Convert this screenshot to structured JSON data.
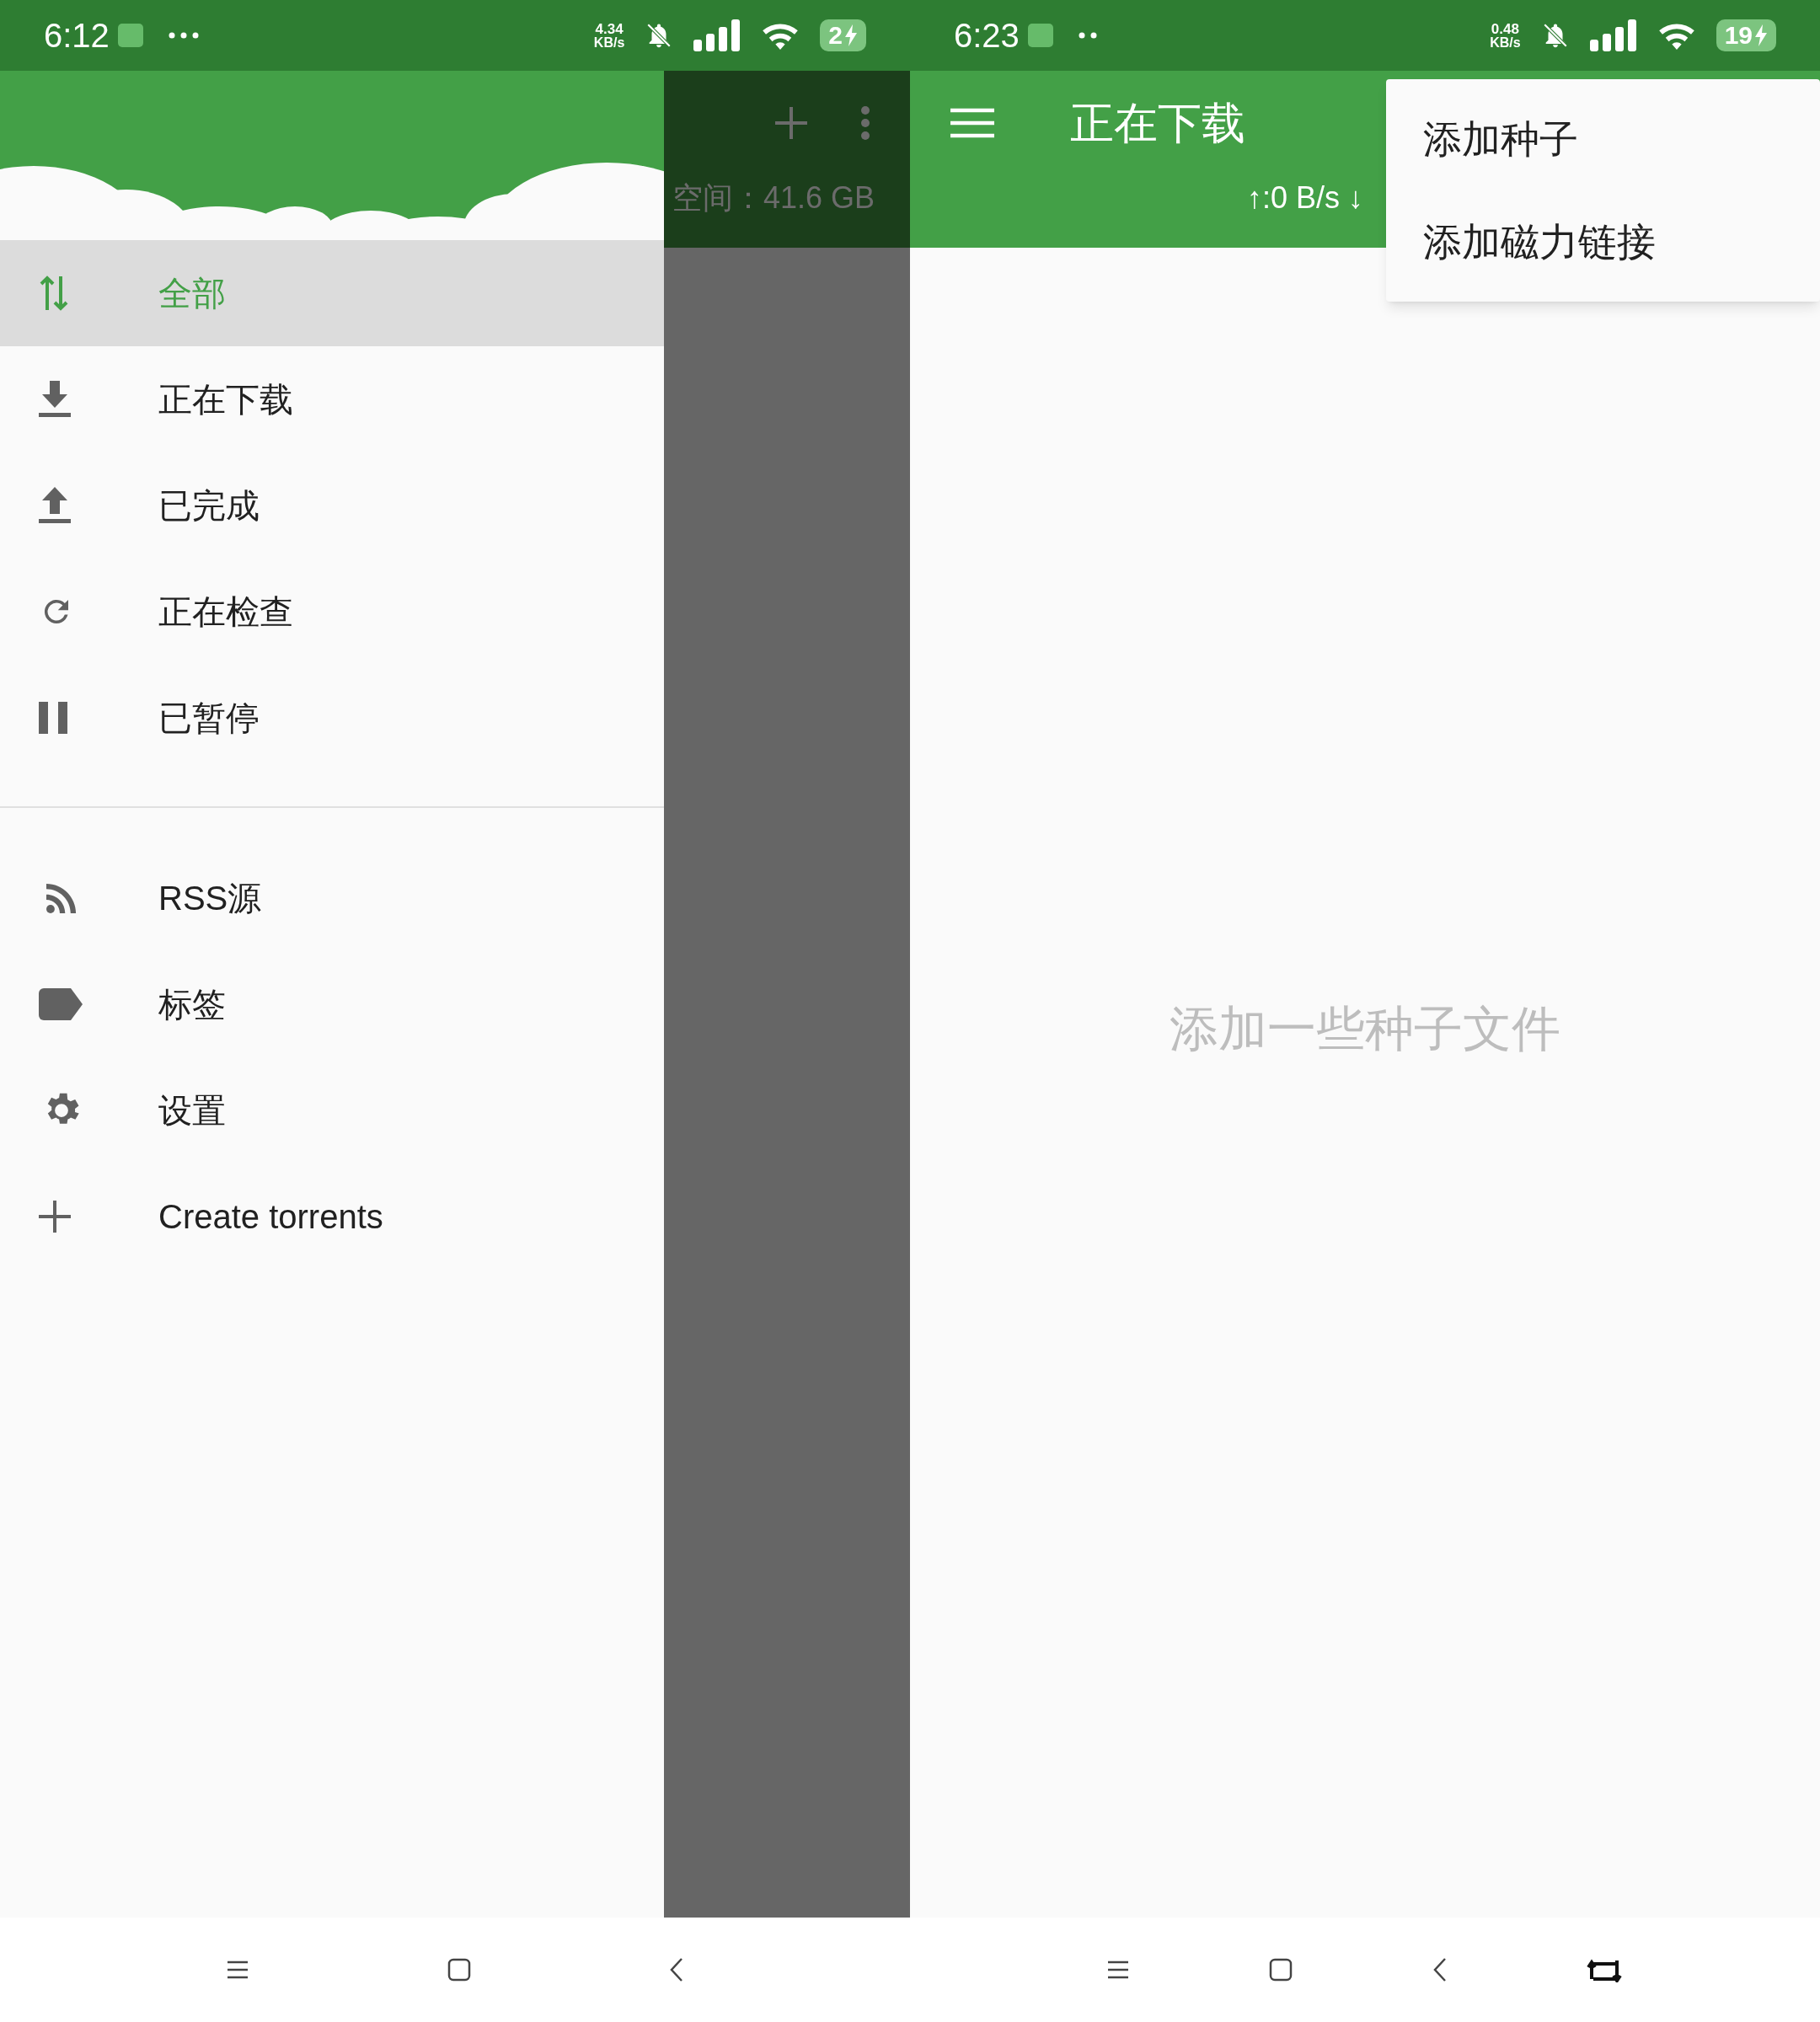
{
  "phones": [
    {
      "status_bar": {
        "time": "6:12",
        "net_speed": "4.34",
        "net_unit": "KB/s",
        "battery": "2"
      },
      "drawer": {
        "filters": [
          {
            "label": "全部",
            "selected": true
          },
          {
            "label": "正在下载",
            "selected": false
          },
          {
            "label": "已完成",
            "selected": false
          },
          {
            "label": "正在检查",
            "selected": false
          },
          {
            "label": "已暂停",
            "selected": false
          }
        ],
        "menu": [
          {
            "label": "RSS源"
          },
          {
            "label": "标签"
          },
          {
            "label": "设置"
          },
          {
            "label": "Create torrents"
          }
        ]
      },
      "background": {
        "free_space": "空间：41.6 GB"
      }
    },
    {
      "status_bar": {
        "time": "6:23",
        "net_speed": "0.48",
        "net_unit": "KB/s",
        "battery": "19"
      },
      "toolbar": {
        "title": "正在下载",
        "speed": "↑:0 B/s ↓"
      },
      "empty_message": "添加一些种子文件",
      "popup_menu": [
        {
          "label": "添加种子"
        },
        {
          "label": "添加磁力链接"
        }
      ]
    }
  ]
}
